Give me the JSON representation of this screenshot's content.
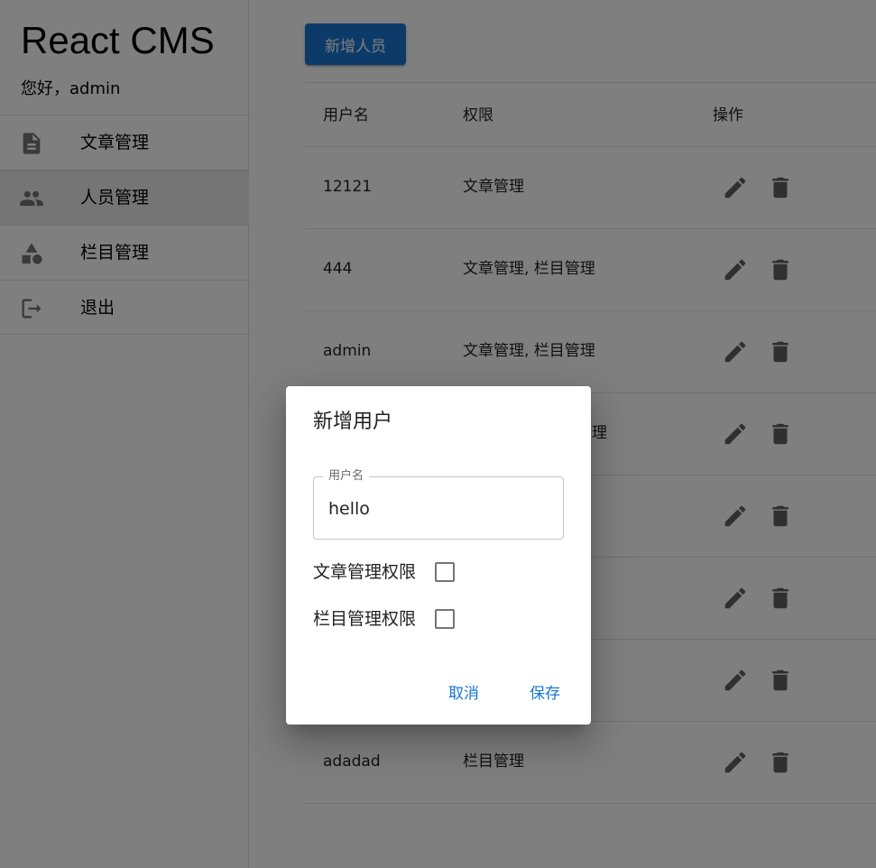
{
  "sidebar": {
    "brand": "React CMS",
    "greeting": "您好，admin",
    "items": [
      {
        "label": "文章管理",
        "icon": "article-icon",
        "active": false
      },
      {
        "label": "人员管理",
        "icon": "people-icon",
        "active": true
      },
      {
        "label": "栏目管理",
        "icon": "category-icon",
        "active": false
      },
      {
        "label": "退出",
        "icon": "logout-icon",
        "active": false
      }
    ]
  },
  "main": {
    "add_button_label": "新增人员",
    "table": {
      "headers": [
        "用户名",
        "权限",
        "操作"
      ],
      "rows": [
        {
          "username": "12121",
          "permissions": "文章管理"
        },
        {
          "username": "444",
          "permissions": "文章管理, 栏目管理"
        },
        {
          "username": "admin",
          "permissions": "文章管理, 栏目管理"
        },
        {
          "username": "",
          "permissions": "理"
        },
        {
          "username": "",
          "permissions": ""
        },
        {
          "username": "",
          "permissions": ""
        },
        {
          "username": "",
          "permissions": ""
        },
        {
          "username": "adadad",
          "permissions": "栏目管理"
        }
      ]
    }
  },
  "dialog": {
    "title": "新增用户",
    "username_label": "用户名",
    "username_value": "hello",
    "perm_article_label": "文章管理权限",
    "perm_article_checked": false,
    "perm_category_label": "栏目管理权限",
    "perm_category_checked": false,
    "cancel_label": "取消",
    "save_label": "保存"
  },
  "colors": {
    "primary": "#1976d2",
    "icon_gray": "#757575",
    "backdrop": "rgba(0,0,0,0.5)"
  }
}
